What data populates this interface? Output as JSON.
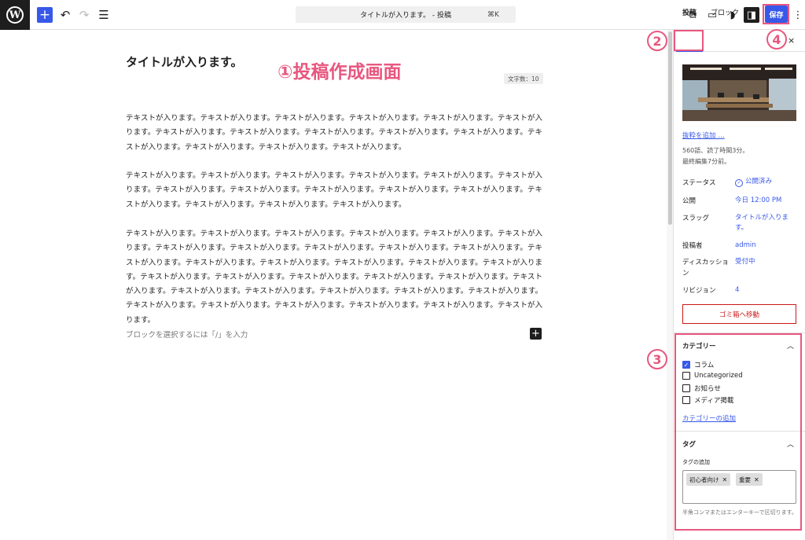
{
  "topbar": {
    "logo": "W",
    "add_icon": "+",
    "undo_icon": "↶",
    "redo_icon": "↷",
    "list_view_icon": "☰",
    "document_title": "タイトルが入ります。 - 投稿",
    "shortcut": "⌘K",
    "external_icon": "⧉",
    "preview_icon": "▭",
    "jetpack_icon": "◗",
    "sidebar_icon": "◨",
    "save_label": "保存",
    "more_icon": "⋮"
  },
  "annotations": {
    "n1": "①投稿作成画面",
    "n2": "2",
    "n3": "3",
    "n4": "4",
    "color": "#e8577e"
  },
  "editor": {
    "title": "タイトルが入ります。",
    "word_count": "文字数：10",
    "paragraphs": [
      "テキストが入ります。テキストが入ります。テキストが入ります。テキストが入ります。テキストが入ります。テキストが入ります。テキストが入ります。テキストが入ります。テキストが入ります。テキストが入ります。テキストが入ります。テキストが入ります。テキストが入ります。テキストが入ります。テキストが入ります。",
      "テキストが入ります。テキストが入ります。テキストが入ります。テキストが入ります。テキストが入ります。テキストが入ります。テキストが入ります。テキストが入ります。テキストが入ります。テキストが入ります。テキストが入ります。テキストが入ります。テキストが入ります。テキストが入ります。テキストが入ります。",
      "テキストが入ります。テキストが入ります。テキストが入ります。テキストが入ります。テキストが入ります。テキストが入ります。テキストが入ります。テキストが入ります。テキストが入ります。テキストが入ります。テキストが入ります。テキストが入ります。テキストが入ります。テキストが入ります。テキストが入ります。テキストが入ります。テキストが入ります。テキストが入ります。テキストが入ります。テキストが入ります。テキストが入ります。テキストが入ります。テキストが入ります。テキストが入ります。テキストが入ります。テキストが入ります。テキストが入ります。テキストが入ります。テキストが入ります。テキストが入ります。テキストが入ります。テキストが入ります。テキストが入ります。テキストが入ります。"
    ],
    "block_placeholder": "ブロックを選択するには「/」を入力",
    "inline_add": "+"
  },
  "sidebar": {
    "tabs": [
      "投稿",
      "ブロック"
    ],
    "close_icon": "×",
    "excerpt_link": "抜粋を追加 …",
    "meta_words": "560語、読了時間3分。",
    "meta_edited": "最終編集7分前。",
    "rows": [
      {
        "label": "ステータス",
        "value": "公開済み"
      },
      {
        "label": "公開",
        "value": "今日 12:00 PM"
      },
      {
        "label": "スラッグ",
        "value": "タイトルが入ります。"
      },
      {
        "label": "投稿者",
        "value": "admin"
      },
      {
        "label": "ディスカッション",
        "value": "受付中"
      },
      {
        "label": "リビジョン",
        "value": "4"
      }
    ],
    "trash_label": "ゴミ箱へ移動",
    "categories": {
      "title": "カテゴリー",
      "items": [
        {
          "label": "コラム",
          "checked": true
        },
        {
          "label": "Uncategorized",
          "checked": false
        },
        {
          "label": "お知らせ",
          "checked": false
        },
        {
          "label": "メディア掲載",
          "checked": false
        }
      ],
      "add_link": "カテゴリーの追加"
    },
    "tags": {
      "title": "タグ",
      "field_label": "タグの追加",
      "chips": [
        "初心者向け",
        "重要"
      ],
      "help": "半角コンマまたはエンターキーで区切ります。"
    },
    "chevron_up": "︿"
  }
}
